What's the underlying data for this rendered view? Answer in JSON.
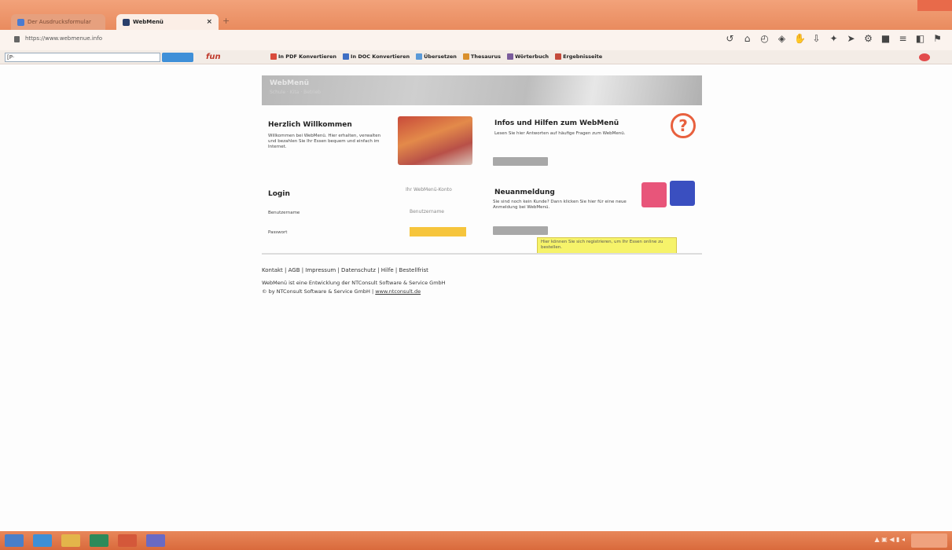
{
  "browser": {
    "tabs": [
      {
        "label": "Der Ausdrucksformular"
      },
      {
        "label": "WebMenü",
        "close": "×"
      }
    ],
    "new_tab": "+",
    "url": "https://www.webmenue.info",
    "nav_icons": [
      "back-arrow-icon",
      "home-icon",
      "history-icon",
      "shield-icon",
      "hand-icon",
      "download-icon",
      "star-icon",
      "send-icon",
      "settings-icon",
      "square-icon",
      "menu-icon",
      "reader-icon",
      "pocket-icon"
    ]
  },
  "bookmarks": {
    "search_placeholder": "",
    "search_prefix": "[P·",
    "brand": "fun",
    "items": [
      {
        "label": "In PDF Konvertieren",
        "color": "#d94b3c"
      },
      {
        "label": "In DOC Konvertieren",
        "color": "#3e6fc4"
      },
      {
        "label": "Übersetzen",
        "color": "#5a9ad8"
      },
      {
        "label": "Thesaurus",
        "color": "#d9902c"
      },
      {
        "label": "Wörterbuch",
        "color": "#7a5c9c"
      },
      {
        "label": "Ergebnisseite",
        "color": "#c44b3c"
      }
    ]
  },
  "page": {
    "banner": {
      "title": "WebMenü",
      "subtitle": "Schule · Kita · Betrieb"
    },
    "welcome": {
      "title": "Herzlich Willkommen",
      "text": "Willkommen bei WebMenü. Hier erhalten, verwalten und bezahlen Sie Ihr Essen bequem und einfach im Internet."
    },
    "info": {
      "title": "Infos und Hilfen zum WebMenü",
      "text": "Lesen Sie hier Antworten auf häufige Fragen zum WebMenü."
    },
    "login": {
      "title": "Login",
      "right_label": "Ihr WebMenü-Konto",
      "user_label": "Benutzername",
      "user_placeholder": "Benutzername",
      "password_label": "Passwort"
    },
    "register": {
      "title": "Neuanmeldung",
      "text": "Sie sind noch kein Kunde? Dann klicken Sie hier für eine neue Anmeldung bei WebMenü."
    },
    "tooltip": "Hier können Sie sich registrieren, um Ihr Essen online zu bestellen.",
    "footer_links": "Kontakt | AGB | Impressum | Datenschutz | Hilfe | Bestellfrist",
    "footer_line1": "WebMenü ist eine Entwicklung der NTConsult Software & Service GmbH",
    "footer_line2_prefix": "© by NTConsult Software & Service GmbH | ",
    "footer_line2_link": "www.ntconsult.de"
  },
  "colors": {
    "accent": "#e8603e",
    "yellow": "#f6c53c",
    "tile_red": "#e8557a",
    "tile_blue": "#3a4fc0"
  }
}
